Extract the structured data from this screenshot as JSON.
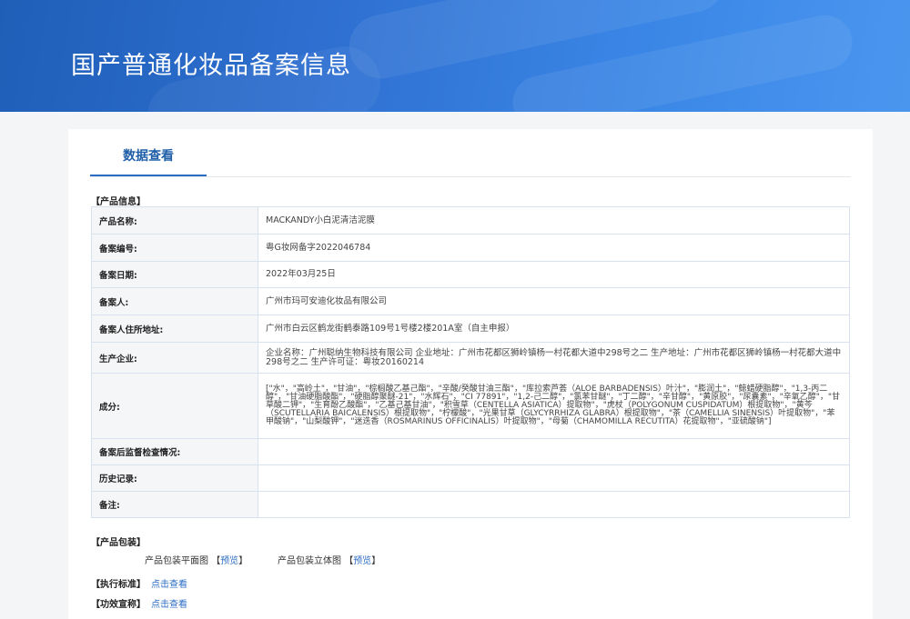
{
  "header": {
    "title": "国产普通化妆品备案信息"
  },
  "tabs": [
    {
      "label": "数据查看"
    }
  ],
  "product_info": {
    "section_title": "【产品信息】",
    "rows": [
      {
        "label": "产品名称:",
        "value": "MACKANDY小白泥清洁泥膜"
      },
      {
        "label": "备案编号:",
        "value": "粤G妆网备字2022046784"
      },
      {
        "label": "备案日期:",
        "value": "2022年03月25日"
      },
      {
        "label": "备案人:",
        "value": "广州市玛可安迪化妆品有限公司"
      },
      {
        "label": "备案人住所地址:",
        "value": "广州市白云区鹤龙街鹤泰路109号1号楼2楼201A室（自主申报）"
      },
      {
        "label": "生产企业:",
        "value": "企业名称：广州聪纳生物科技有限公司 企业地址：广州市花都区狮岭镇杨一村花都大道中298号之二 生产地址：广州市花都区狮岭镇杨一村花都大道中298号之二 生产许可证：粤妆20160214"
      },
      {
        "label": "成分:",
        "value": "[\"水\"，\"高岭土\"，\"甘油\"，\"棕榈酸乙基己酯\"，\"辛酸/癸酸甘油三酯\"，\"库拉索芦荟（ALOE BARBADENSIS）叶汁\"，\"膨润土\"，\"鲸蜡硬脂醇\"，\"1,3-丙二醇\"，\"甘油硬脂酸酯\"，\"硬脂醇聚醚-21\"，\"水辉石\"，\"CI 77891\"，\"1,2-己二醇\"，\"氯苯甘醚\"，\"丁二醇\"，\"辛甘醇\"，\"黄原胶\"，\"尿囊素\"，\"辛氧乙醇\"，\"甘草酸二钾\"，\"生育酚乙酸酯\"，\"乙基己基甘油\"，\"积雪草（CENTELLA ASIATICA）提取物\"，\"虎杖（POLYGONUM CUSPIDATUM）根提取物\"，\"黄芩（SCUTELLARIA BAICALENSIS）根提取物\"，\"柠檬酸\"，\"光果甘草（GLYCYRRHIZA GLABRA）根提取物\"，\"茶（CAMELLIA SINENSIS）叶提取物\"，\"苯甲酸钠\"，\"山梨酸钾\"，\"迷迭香（ROSMARINUS OFFICINALIS）叶提取物\"，\"母菊（CHAMOMILLA RECUTITA）花提取物\"，\"亚硫酸钠\"]"
      },
      {
        "label": "备案后监督检查情况:",
        "value": ""
      },
      {
        "label": "历史记录:",
        "value": ""
      },
      {
        "label": "备注:",
        "value": ""
      }
    ]
  },
  "packaging": {
    "section_title": "【产品包装】",
    "flat": {
      "label": "产品包装平面图",
      "bracket_open": "【",
      "link": "预览",
      "bracket_close": "】"
    },
    "solid": {
      "label": "产品包装立体图",
      "bracket_open": "【",
      "link": "预览",
      "bracket_close": "】"
    }
  },
  "standard": {
    "label": "【执行标准】",
    "link": "点击查看"
  },
  "efficacy": {
    "label": "【功效宣称】",
    "link": "点击查看"
  },
  "colors": {
    "banner": "#2e6fd0",
    "accent": "#2b6cc4",
    "table_border": "#b7cde6",
    "key_bg": "#f5f6f8"
  }
}
